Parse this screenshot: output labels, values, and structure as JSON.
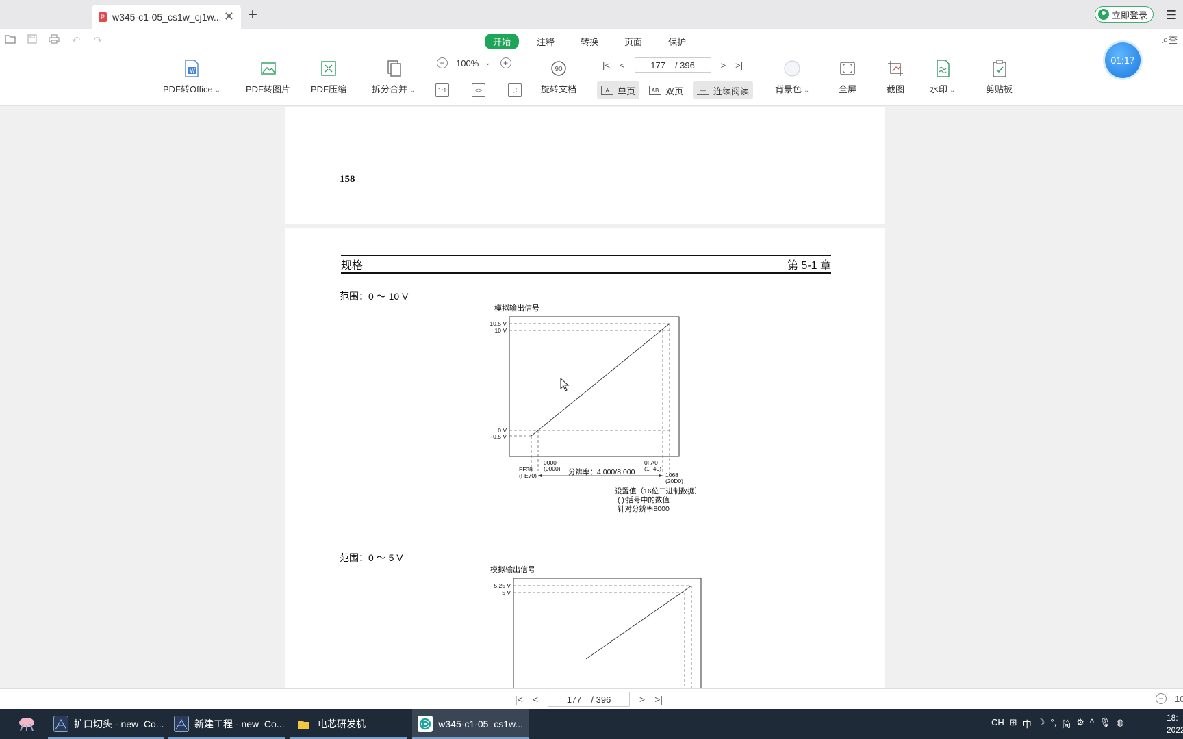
{
  "tab": {
    "title": "w345-c1-05_cs1w_cj1w...",
    "close": "✕",
    "new": "+"
  },
  "account": {
    "login": "立即登录"
  },
  "menu_tabs": [
    {
      "label": "开始",
      "active": true
    },
    {
      "label": "注释",
      "active": false
    },
    {
      "label": "转换",
      "active": false
    },
    {
      "label": "页面",
      "active": false
    },
    {
      "label": "保护",
      "active": false
    }
  ],
  "timer": "01:17",
  "search_partial": "查",
  "tools": {
    "pdf_to_office": "PDF转Office",
    "pdf_to_image": "PDF转图片",
    "pdf_compress": "PDF压缩",
    "split_merge": "拆分合并",
    "rotate": "旋转文档",
    "rotate_badge": "90",
    "background": "背景色",
    "fullscreen": "全屏",
    "screenshot": "截图",
    "watermark": "水印",
    "clipboard": "剪贴板"
  },
  "zoom": {
    "value": "100%",
    "fit_label": "1:1"
  },
  "nav": {
    "current": "177",
    "total": "/ 396"
  },
  "view_modes": {
    "single": "单页",
    "double": "双页",
    "continuous": "连续阅读"
  },
  "document": {
    "page_number": "158",
    "header_left": "规格",
    "header_right": "第 5-1 章",
    "range1": "范围：0 ～ 10 V",
    "range2": "范围：0 ～ 5 V",
    "chart1": {
      "title": "模拟输出信号",
      "y_labels": [
        "10.5 V",
        "10 V",
        "0 V",
        "–0.5 V"
      ],
      "x_left": [
        "FF38",
        "(FE70)"
      ],
      "x_mid": [
        "0000",
        "(0000)"
      ],
      "x_right1": [
        "0FA0",
        "(1F40)"
      ],
      "x_right2": [
        "1068",
        "(20D0)"
      ],
      "resolution": "分辨率：4,000/8,000",
      "note1": "设置值（16位二进制数据）",
      "note2": "( ):括号中的数值",
      "note3": "针对分辨率8000"
    },
    "chart2": {
      "title": "模拟输出信号",
      "y_labels": [
        "5.25 V",
        "5 V"
      ]
    }
  },
  "bottom_nav": {
    "current": "177",
    "total": "/ 396",
    "zoom_partial": "10"
  },
  "taskbar": {
    "items": [
      "扩口切头 - new_Co...",
      "新建工程 - new_Co...",
      "电芯研发机",
      "w345-c1-05_cs1w..."
    ],
    "tray": [
      "CH",
      "中",
      "简"
    ],
    "time": "18:",
    "date": "2022/"
  }
}
